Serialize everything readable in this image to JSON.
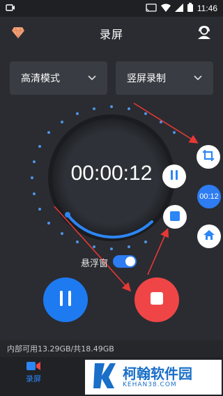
{
  "status_bar": {
    "time": "11:46"
  },
  "app_bar": {
    "title": "录屏"
  },
  "dropdowns": {
    "quality": "高清模式",
    "orientation": "竖屏录制"
  },
  "timer": {
    "elapsed": "00:00:12"
  },
  "floating_panel": {
    "timer_badge": "00:12"
  },
  "float_window": {
    "label": "悬浮窗",
    "enabled": true
  },
  "storage": {
    "text": "内部可用13.29GB/共18.49GB"
  },
  "bottom_nav": {
    "tabs": [
      {
        "label": "录屏",
        "active": true
      }
    ]
  },
  "watermark": {
    "title": "柯翰软件园",
    "url": "KEHAN38.COM"
  },
  "colors": {
    "accent_blue": "#2d86f5",
    "stop_red": "#f04546",
    "background": "#2a2c31"
  }
}
